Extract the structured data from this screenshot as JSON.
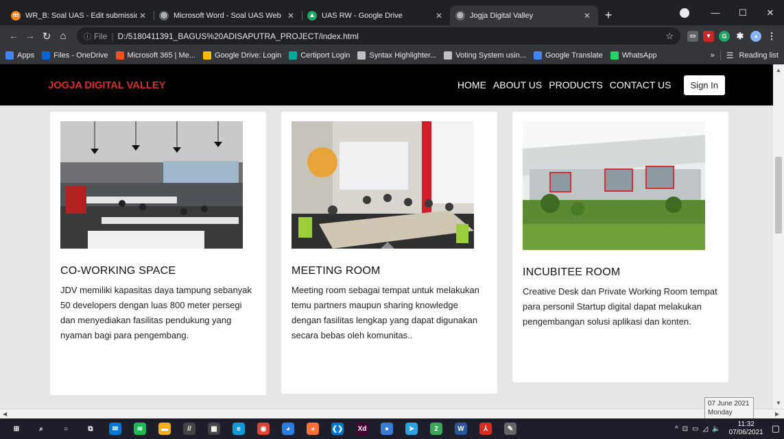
{
  "browser": {
    "tabs": [
      {
        "title": "WR_B: Soal UAS - Edit submission",
        "icon": "moodle-icon",
        "color": "#f98012",
        "glyph": "m"
      },
      {
        "title": "Microsoft Word - Soal UAS Web",
        "icon": "globe-icon",
        "color": "#5f6368",
        "glyph": "◎"
      },
      {
        "title": "UAS RW - Google Drive",
        "icon": "drive-icon",
        "color": "#1fa463",
        "glyph": "▲"
      },
      {
        "title": "Jogja Digital Valley",
        "icon": "globe-icon",
        "color": "#5f6368",
        "glyph": "◎"
      }
    ],
    "active_tab": 3,
    "new_tab": "+",
    "window_controls": [
      "—",
      "☐",
      "✕"
    ],
    "omnibox": {
      "info": "ⓘ",
      "scheme": "File",
      "url": "D:/5180411391_BAGUS%20ADISAPUTRA_PROJECT/index.html"
    },
    "bookmarks": [
      {
        "label": "Apps",
        "icon": "apps-grid-icon",
        "color": "#4285f4"
      },
      {
        "label": "Files - OneDrive",
        "icon": "onedrive-icon",
        "color": "#0a64d8"
      },
      {
        "label": "Microsoft 365 | Me...",
        "icon": "microsoft-icon",
        "color": "#f25022"
      },
      {
        "label": "Google Drive: Login",
        "icon": "drive-icon",
        "color": "#fbbc04"
      },
      {
        "label": "Certiport Login",
        "icon": "certiport-icon",
        "color": "#00a99d"
      },
      {
        "label": "Syntax Highlighter...",
        "icon": "globe-icon",
        "color": "#bdc1c6"
      },
      {
        "label": "Voting System usin...",
        "icon": "globe-icon",
        "color": "#bdc1c6"
      },
      {
        "label": "Google Translate",
        "icon": "translate-icon",
        "color": "#4285f4"
      },
      {
        "label": "WhatsApp",
        "icon": "whatsapp-icon",
        "color": "#25d366"
      }
    ],
    "bookmarks_more": "»",
    "reading_list": "Reading list"
  },
  "site": {
    "brand": "JOGJA DIGITAL VALLEY",
    "nav": [
      "HOME",
      "ABOUT US",
      "PRODUCTS",
      "CONTACT US"
    ],
    "signin": "Sign In",
    "brand_color": "#d92b2b"
  },
  "cards": [
    {
      "title": "CO-WORKING SPACE",
      "text": "JDV memiliki kapasitas daya tampung sebanyak 50 developers dengan luas 800 meter persegi dan menyediakan fasilitas pendukung yang nyaman bagi para pengembang."
    },
    {
      "title": "MEETING ROOM",
      "text": "Meeting room sebagai tempat untuk melakukan temu partners maupun sharing knowledge dengan fasilitas lengkap yang dapat digunakan secara bebas oleh komunitas.."
    },
    {
      "title": "INCUBITEE ROOM",
      "text": "Creative Desk dan Private Working Room tempat para personil Startup digital dapat melakukan pengembangan solusi aplikasi dan konten."
    }
  ],
  "taskbar": {
    "apps": [
      {
        "icon": "windows-start-icon",
        "color": "#1e1e2a",
        "glyph": "⊞"
      },
      {
        "icon": "search-icon",
        "color": "#1e1e2a",
        "glyph": "⌕"
      },
      {
        "icon": "cortana-icon",
        "color": "#1e1e2a",
        "glyph": "○"
      },
      {
        "icon": "task-view-icon",
        "color": "#1e1e2a",
        "glyph": "⧉"
      },
      {
        "icon": "mail-icon",
        "color": "#0078d4",
        "glyph": "✉"
      },
      {
        "icon": "spotify-icon",
        "color": "#1db954",
        "glyph": "≋"
      },
      {
        "icon": "file-explorer-icon",
        "color": "#f2b01e",
        "glyph": "▬"
      },
      {
        "icon": "pen-app-icon",
        "color": "#444444",
        "glyph": "//"
      },
      {
        "icon": "calendar-app-icon",
        "color": "#444444",
        "glyph": "▦"
      },
      {
        "icon": "edge-icon",
        "color": "#0f9bd7",
        "glyph": "e"
      },
      {
        "icon": "chrome-icon",
        "color": "#db4437",
        "glyph": "◉"
      },
      {
        "icon": "firefox-dev-icon",
        "color": "#2a7de1",
        "glyph": "◕"
      },
      {
        "icon": "firefox-icon",
        "color": "#ff7139",
        "glyph": "◕"
      },
      {
        "icon": "vscode-icon",
        "color": "#007acc",
        "glyph": "❮❯"
      },
      {
        "icon": "adobe-xd-icon",
        "color": "#470137",
        "glyph": "Xd"
      },
      {
        "icon": "app-icon",
        "color": "#3a7bd5",
        "glyph": "●"
      },
      {
        "icon": "telegram-icon",
        "color": "#2aa3e0",
        "glyph": "➤"
      },
      {
        "icon": "game-app-icon",
        "color": "#3ba55c",
        "glyph": "2"
      },
      {
        "icon": "word-icon",
        "color": "#2b579a",
        "glyph": "W"
      },
      {
        "icon": "acrobat-icon",
        "color": "#d62d20",
        "glyph": "⅄"
      },
      {
        "icon": "tool-app-icon",
        "color": "#666666",
        "glyph": "✎"
      }
    ],
    "tray_icons": [
      "^",
      "⊡",
      "▭",
      "◿",
      "🔈"
    ],
    "time": "11:32",
    "date": "07/06/2021",
    "tooltip": {
      "line1": "07 June 2021",
      "line2": "Monday"
    }
  }
}
